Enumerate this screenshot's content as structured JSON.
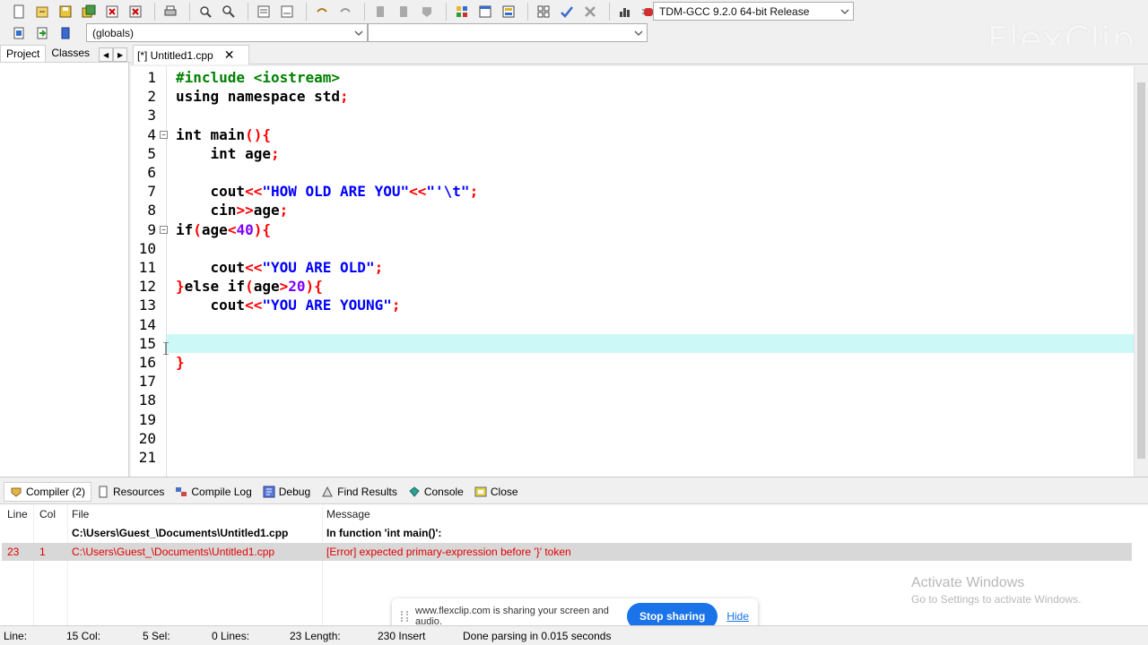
{
  "toolbar": {
    "compiler_select": "TDM-GCC 9.2.0 64-bit Release",
    "scope_select": "(globals)",
    "symbol_select": "",
    "icons_row1": [
      "new-file-icon",
      "open-file-icon",
      "save-icon",
      "save-all-icon",
      "close-icon",
      "close-all-icon",
      "print-icon",
      "find-icon",
      "replace-icon",
      "indent-icon",
      "unindent-icon",
      "undo-icon",
      "redo-icon",
      "bookmark-prev-icon",
      "bookmark-next-icon",
      "toggle-bookmark-icon",
      "grid-icon",
      "window-icon",
      "project-icon",
      "options-icon",
      "check-icon",
      "cross-icon",
      "chart-icon",
      "debug-icon"
    ],
    "icons_row2": [
      "class-browser-icon",
      "goto-icon",
      "insert-icon"
    ]
  },
  "left_panel": {
    "tabs": [
      "Project",
      "Classes"
    ],
    "active_tab": "Project"
  },
  "editor": {
    "tab_label": "[*] Untitled1.cpp",
    "lines": [
      {
        "n": "1",
        "code": "#include <iostream>"
      },
      {
        "n": "2",
        "code": "using namespace std;"
      },
      {
        "n": "3",
        "code": ""
      },
      {
        "n": "4",
        "code": "int main(){"
      },
      {
        "n": "5",
        "code": "    int age;"
      },
      {
        "n": "6",
        "code": ""
      },
      {
        "n": "7",
        "code": "    cout<<\"HOW OLD ARE YOU\"<<\"'\\t\";"
      },
      {
        "n": "8",
        "code": "    cin>>age;"
      },
      {
        "n": "9",
        "code": "if(age<40){"
      },
      {
        "n": "10",
        "code": ""
      },
      {
        "n": "11",
        "code": "    cout<<\"YOU ARE OLD\";"
      },
      {
        "n": "12",
        "code": "}else if(age>20){"
      },
      {
        "n": "13",
        "code": "    cout<<\"YOU ARE YOUNG\";"
      },
      {
        "n": "14",
        "code": ""
      },
      {
        "n": "15",
        "code": ""
      },
      {
        "n": "16",
        "code": "}"
      },
      {
        "n": "17",
        "code": ""
      },
      {
        "n": "18",
        "code": ""
      },
      {
        "n": "19",
        "code": ""
      },
      {
        "n": "20",
        "code": ""
      },
      {
        "n": "21",
        "code": ""
      }
    ],
    "active_line": 15
  },
  "bottom_tabs": [
    "Compiler (2)",
    "Resources",
    "Compile Log",
    "Debug",
    "Find Results",
    "Console",
    "Close"
  ],
  "compiler": {
    "headers": {
      "line": "Line",
      "col": "Col",
      "file": "File",
      "message": "Message"
    },
    "rows": [
      {
        "line": "",
        "col": "",
        "file": "C:\\Users\\Guest_\\Documents\\Untitled1.cpp",
        "message": "In function 'int main()':",
        "type": "info"
      },
      {
        "line": "23",
        "col": "1",
        "file": "C:\\Users\\Guest_\\Documents\\Untitled1.cpp",
        "message": "[Error] expected primary-expression before '}' token",
        "type": "error"
      }
    ]
  },
  "watermark": "FlexClip",
  "activate_windows": {
    "title": "Activate Windows",
    "subtitle": "Go to Settings to activate Windows."
  },
  "share_bar": {
    "text": "www.flexclip.com is sharing your screen and audio.",
    "stop": "Stop sharing",
    "hide": "Hide"
  },
  "status": {
    "line": "Line:",
    "col": "15 Col:",
    "sel": "5 Sel:",
    "lines": "0 Lines:",
    "length": "23 Length:",
    "insert": "230 Insert",
    "parse": "Done parsing in 0.015 seconds"
  }
}
